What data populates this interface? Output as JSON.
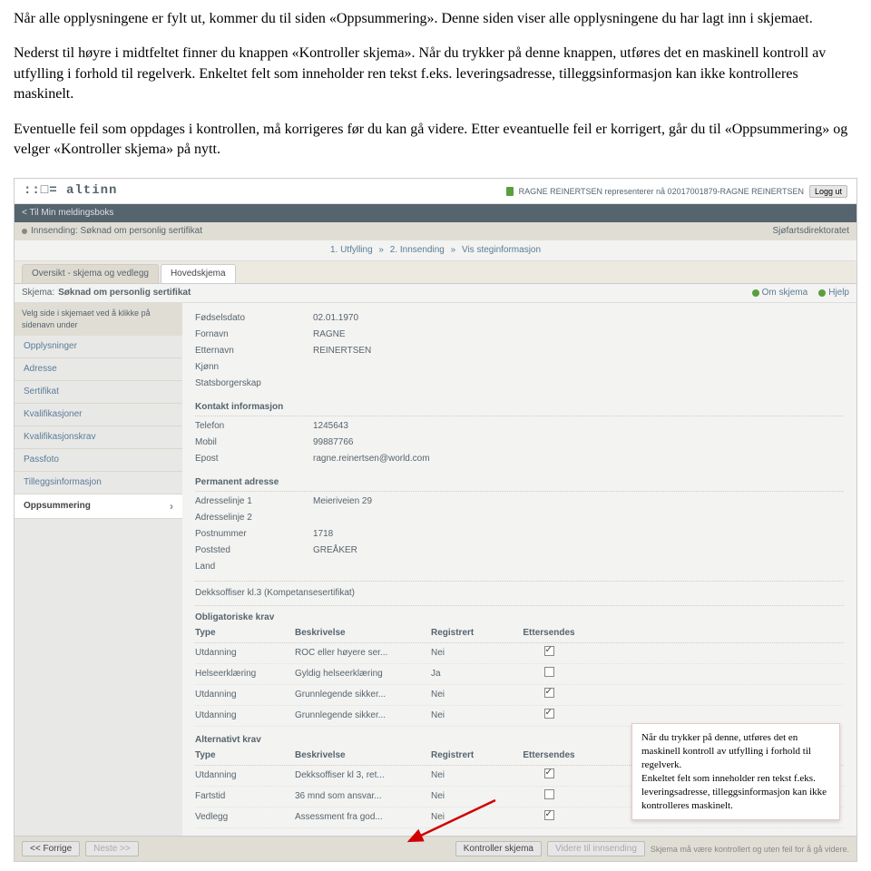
{
  "instructions": {
    "p1": "Når alle opplysningene er fylt ut, kommer du til siden «Oppsummering». Denne siden viser alle opplysningene du har lagt inn i skjemaet.",
    "p2": "Nederst til høyre i midtfeltet finner du knappen «Kontroller skjema». Når du trykker på denne knappen, utføres det en maskinell kontroll av utfylling i forhold til regelverk. Enkeltet felt som inneholder ren tekst f.eks. leveringsadresse, tilleggsinformasjon kan ikke kontrolleres maskinelt.",
    "p3": "Eventuelle feil som oppdages i kontrollen, må korrigeres før du kan gå videre. Etter eveantuelle feil er korrigert, går du til «Oppsummering» og velger «Kontroller skjema» på nytt."
  },
  "header": {
    "logo": "::□= altinn",
    "user_text": "RAGNE REINERTSEN representerer nå 02017001879-RAGNE REINERTSEN",
    "logout": "Logg ut"
  },
  "darkbar": "< Til Min meldingsboks",
  "submitbar": {
    "left": "Innsending: Søknad om personlig sertifikat",
    "right": "Sjøfartsdirektoratet"
  },
  "steps": {
    "s1": "1. Utfylling",
    "arrow": "»",
    "s2": "2. Innsending",
    "link": "Vis steginformasjon"
  },
  "tabs": {
    "t1": "Oversikt - skjema og vedlegg",
    "t2": "Hovedskjema"
  },
  "schema_line": {
    "label": "Skjema:",
    "value": "Søknad om personlig sertifikat",
    "om": "Om skjema",
    "hjelp": "Hjelp"
  },
  "sidebar": {
    "header": "Velg side i skjemaet ved å klikke på sidenavn under",
    "items": [
      "Opplysninger",
      "Adresse",
      "Sertifikat",
      "Kvalifikasjoner",
      "Kvalifikasjonskrav",
      "Passfoto",
      "Tilleggsinformasjon",
      "Oppsummering"
    ]
  },
  "fields": {
    "fodselsdato": {
      "label": "Fødselsdato",
      "value": "02.01.1970"
    },
    "fornavn": {
      "label": "Fornavn",
      "value": "RAGNE"
    },
    "etternavn": {
      "label": "Etternavn",
      "value": "REINERTSEN"
    },
    "kjonn": {
      "label": "Kjønn",
      "value": ""
    },
    "statsborgerskap": {
      "label": "Statsborgerskap",
      "value": ""
    }
  },
  "kontakt": {
    "head": "Kontakt informasjon",
    "telefon": {
      "label": "Telefon",
      "value": "1245643"
    },
    "mobil": {
      "label": "Mobil",
      "value": "99887766"
    },
    "epost": {
      "label": "Epost",
      "value": "ragne.reinertsen@world.com"
    }
  },
  "adresse": {
    "head": "Permanent adresse",
    "linje1": {
      "label": "Adresselinje 1",
      "value": "Meieriveien 29"
    },
    "linje2": {
      "label": "Adresselinje 2",
      "value": ""
    },
    "postnr": {
      "label": "Postnummer",
      "value": "1718"
    },
    "poststed": {
      "label": "Poststed",
      "value": "GREÅKER"
    },
    "land": {
      "label": "Land",
      "value": ""
    }
  },
  "sertifikat_line": "Dekksoffiser kl.3 (Kompetansesertifikat)",
  "oblig": {
    "head": "Obligatoriske krav",
    "cols": {
      "type": "Type",
      "desc": "Beskrivelse",
      "reg": "Registrert",
      "etter": "Ettersendes"
    },
    "rows": [
      {
        "type": "Utdanning",
        "desc": "ROC eller høyere ser...",
        "reg": "Nei",
        "etter": true
      },
      {
        "type": "Helseerklæring",
        "desc": "Gyldig helseerklæring",
        "reg": "Ja",
        "etter": false
      },
      {
        "type": "Utdanning",
        "desc": "Grunnlegende sikker...",
        "reg": "Nei",
        "etter": true
      },
      {
        "type": "Utdanning",
        "desc": "Grunnlegende sikker...",
        "reg": "Nei",
        "etter": true
      }
    ]
  },
  "alt": {
    "head": "Alternativt krav",
    "rows": [
      {
        "type": "Utdanning",
        "desc": "Dekksoffiser kl 3, ret...",
        "reg": "Nei",
        "etter": true
      },
      {
        "type": "Fartstid",
        "desc": "36 mnd som ansvar...",
        "reg": "Nei",
        "etter": false
      },
      {
        "type": "Vedlegg",
        "desc": "Assessment fra god...",
        "reg": "Nei",
        "etter": true
      }
    ]
  },
  "bottombar": {
    "prev": "<< Forrige",
    "next": "Neste >>",
    "kontroller": "Kontroller skjema",
    "videre": "Videre til innsending",
    "info": "Skjema må være kontrollert og uten feil for å gå videre."
  },
  "callout": "Når du trykker på denne, utføres det en maskinell kontroll av utfylling i forhold til regelverk.\nEnkeltet felt som inneholder ren tekst f.eks. leveringsadresse, tilleggsinformasjon kan ikke kontrolleres maskinelt."
}
